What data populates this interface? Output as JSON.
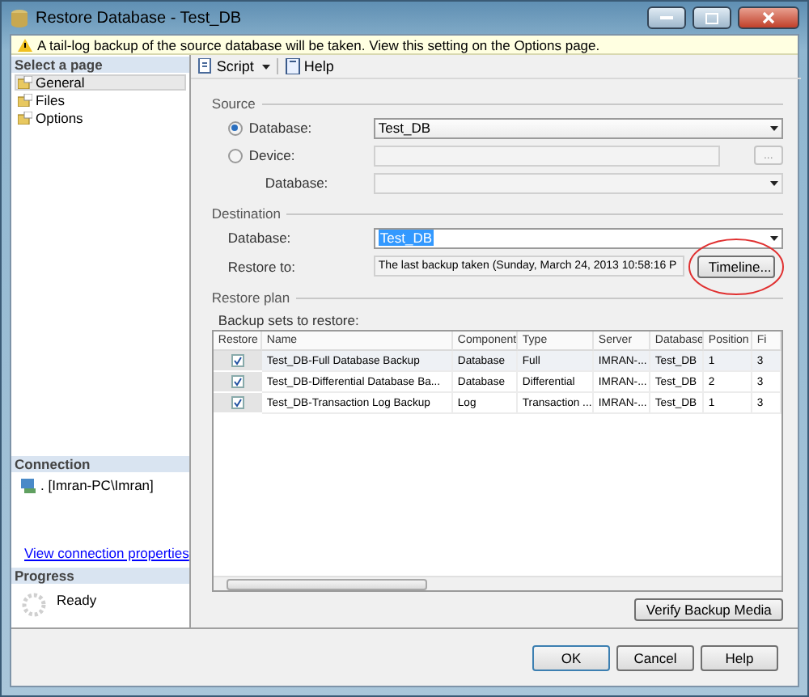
{
  "window": {
    "title": "Restore Database - Test_DB"
  },
  "warning": "A tail-log backup of the source database will be taken. View this setting on the Options page.",
  "sidebar": {
    "header": "Select a page",
    "items": [
      {
        "label": "General",
        "selected": true
      },
      {
        "label": "Files",
        "selected": false
      },
      {
        "label": "Options",
        "selected": false
      }
    ]
  },
  "connection": {
    "header": "Connection",
    "server": ". [Imran-PC\\Imran]",
    "link": "View connection properties"
  },
  "progress": {
    "header": "Progress",
    "status": "Ready"
  },
  "toolbar": [
    {
      "label": "Script",
      "kind": "dropdown"
    },
    {
      "label": "Help",
      "kind": "help"
    }
  ],
  "source": {
    "title": "Source",
    "options": [
      {
        "label": "Database:",
        "selected": true,
        "value": "Test_DB"
      },
      {
        "label": "Device:",
        "selected": false
      }
    ],
    "database_label": "Database:",
    "browse_button": "..."
  },
  "destination": {
    "title": "Destination",
    "database_label": "Database:",
    "database": "Test_DB",
    "restore_label": "Restore to:",
    "restore_to": "The last backup taken (Sunday, March 24, 2013 10:58:16 P",
    "timeline_button": "Timeline..."
  },
  "restore_plan": {
    "title": "Restore plan",
    "caption": "Backup sets to restore:",
    "check_column": "Restore",
    "columns": [
      "Name",
      "Component",
      "Type",
      "Server",
      "Database",
      "Position",
      "Fi"
    ],
    "rows": [
      {
        "checked": true,
        "selected": true,
        "cells": [
          "Test_DB-Full Database Backup",
          "Database",
          "Full",
          "IMRAN-...",
          "Test_DB",
          "1",
          "3"
        ]
      },
      {
        "checked": true,
        "selected": false,
        "cells": [
          "Test_DB-Differential Database Ba...",
          "Database",
          "Differential",
          "IMRAN-...",
          "Test_DB",
          "2",
          "3"
        ]
      },
      {
        "checked": true,
        "selected": false,
        "cells": [
          "Test_DB-Transaction Log  Backup",
          "Log",
          "Transaction ...",
          "IMRAN-...",
          "Test_DB",
          "1",
          "3"
        ]
      }
    ],
    "verify_button": "Verify Backup Media"
  },
  "buttons": [
    "OK",
    "Cancel",
    "Help"
  ]
}
